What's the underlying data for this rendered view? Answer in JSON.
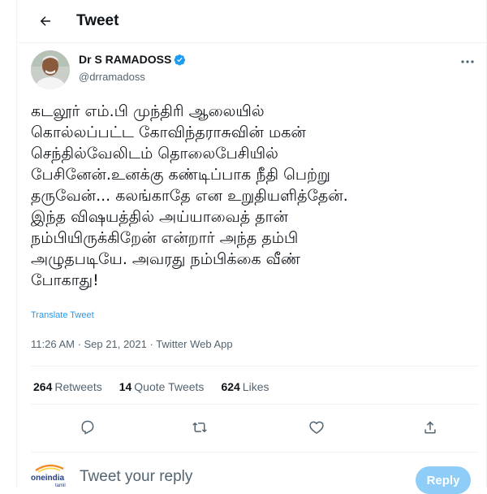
{
  "header": {
    "title": "Tweet",
    "back_icon": "arrow-left-icon"
  },
  "author": {
    "name": "Dr S RAMADOSS",
    "handle": "@drramadoss",
    "verified": true,
    "verified_color": "#1d9bf0"
  },
  "tweet": {
    "text": "கடலூர் எம்.பி முந்திரி ஆலையில்\nகொல்லப்பட்ட  கோவிந்தராசுவின் மகன்\nசெந்தில்வேலிடம் தொலைபேசியில்\nபேசினேன்.உனக்கு கண்டிப்பாக நீதி பெற்று\nதருவேன்... கலங்காதே என உறுதியளித்தேன்.\nஇந்த விஷயத்தில் அய்யாவைத் தான்\nநம்பியிருக்கிறேன் என்றார் அந்த தம்பி\nஅழுதபடியே. அவரது நம்பிக்கை வீண்\nபோகாது!",
    "translate_label": "Translate Tweet",
    "time": "11:26 AM · Sep 21, 2021 · ",
    "source": "Twitter Web App"
  },
  "stats": {
    "retweets_count": "264",
    "retweets_label": "Retweets",
    "quotes_count": "14",
    "quotes_label": "Quote Tweets",
    "likes_count": "624",
    "likes_label": "Likes"
  },
  "actions": [
    "reply-icon",
    "retweet-icon",
    "like-icon",
    "share-icon"
  ],
  "reply": {
    "placeholder": "Tweet your reply",
    "button_label": "Reply",
    "watermark_text": "oneindia",
    "watermark_sub": "tamil"
  },
  "colors": {
    "accent": "#1d9bf0",
    "muted": "#536471",
    "text": "#0f1419",
    "reply_button": "#8ecdf7"
  }
}
